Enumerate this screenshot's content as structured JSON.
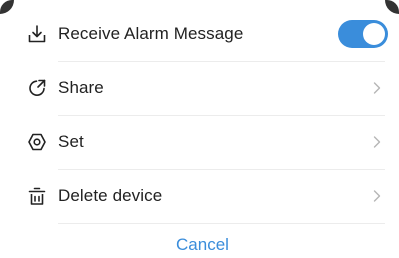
{
  "menu": {
    "items": [
      {
        "label": "Receive Alarm Message",
        "icon": "download-tray-icon",
        "control": "toggle",
        "toggle_on": true
      },
      {
        "label": "Share",
        "icon": "share-arrow-icon",
        "control": "chevron"
      },
      {
        "label": "Set",
        "icon": "hexagon-settings-icon",
        "control": "chevron"
      },
      {
        "label": "Delete device",
        "icon": "trash-icon",
        "control": "chevron"
      }
    ]
  },
  "cancel_label": "Cancel",
  "colors": {
    "accent": "#3a8ddb",
    "text": "#222222",
    "divider": "#ececec",
    "chevron": "#b5b5b5"
  }
}
